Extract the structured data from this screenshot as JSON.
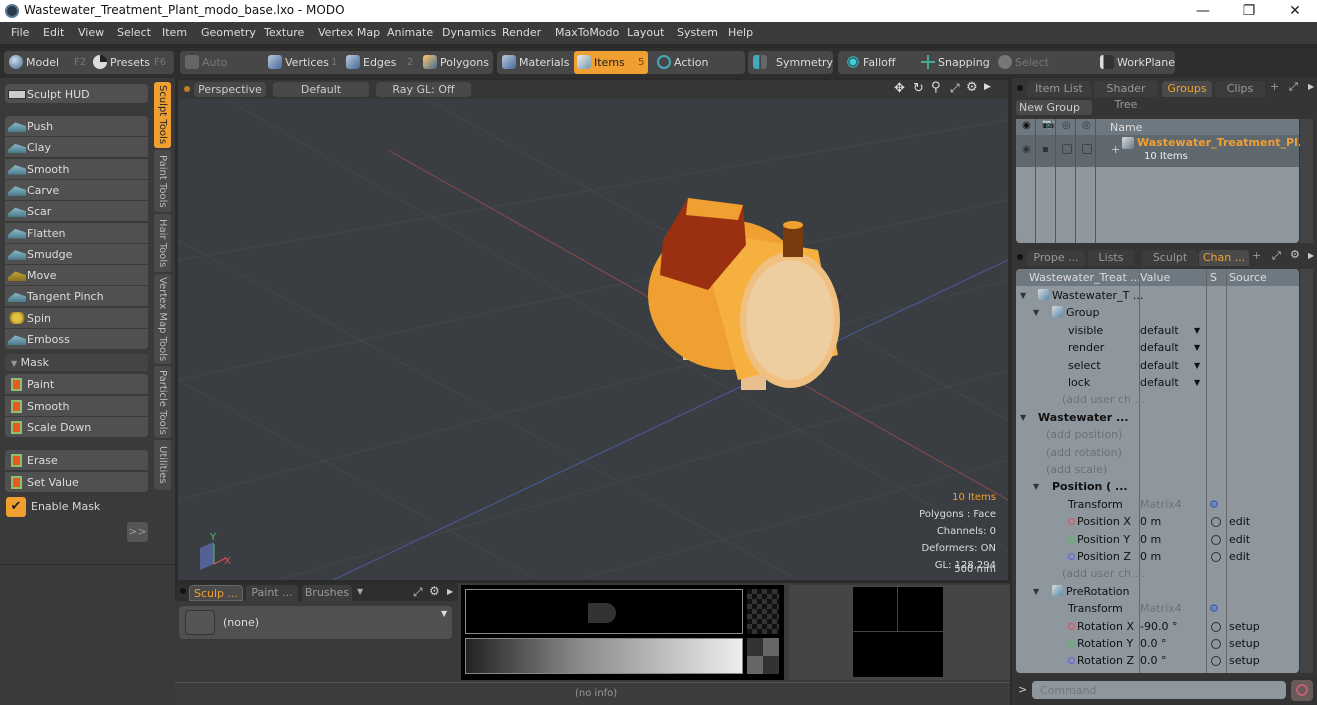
{
  "window": {
    "title": "Wastewater_Treatment_Plant_modo_base.lxo - MODO",
    "minimize": "—",
    "restore": "❐",
    "close": "✕"
  },
  "menu": [
    "File",
    "Edit",
    "View",
    "Select",
    "Item",
    "Geometry",
    "Texture",
    "Vertex Map",
    "Animate",
    "Dynamics",
    "Render",
    "MaxToModo",
    "Layout",
    "System",
    "Help"
  ],
  "toolbar": {
    "model": "Model",
    "model_key": "F2",
    "presets": "Presets",
    "presets_key": "F6",
    "auto_select": "Auto Select",
    "vertices": "Vertices",
    "vertices_key": "1",
    "edges": "Edges",
    "edges_key": "2",
    "polygons": "Polygons",
    "materials": "Materials",
    "items": "Items",
    "items_key": "5",
    "action_center": "Action Center",
    "symmetry": "Symmetry",
    "falloff": "Falloff",
    "snapping": "Snapping",
    "select_through": "Select Through",
    "workplane": "WorkPlane"
  },
  "left": {
    "hud": "Sculpt HUD",
    "tools": [
      "Push",
      "Clay",
      "Smooth",
      "Carve",
      "Scar",
      "Flatten",
      "Smudge",
      "Move",
      "Tangent Pinch",
      "Spin",
      "Emboss"
    ],
    "mask_header": "Mask",
    "mask_tools": [
      "Paint",
      "Smooth",
      "Scale Down"
    ],
    "mask_tools2": [
      "Erase",
      "Set Value"
    ],
    "enable_mask": "Enable Mask",
    "enable_mask_checked": true,
    "more": ">>",
    "vtabs": [
      "Sculpt Tools",
      "Paint Tools",
      "Hair Tools",
      "Vertex Map Tools",
      "Particle Tools",
      "Utilities"
    ]
  },
  "viewport": {
    "view": "Perspective",
    "shading": "Default",
    "raygl": "Ray GL: Off",
    "info": [
      "10 Items",
      "Polygons : Face",
      "Channels: 0",
      "Deformers: ON",
      "GL: 128,294",
      "500 mm"
    ],
    "axis_x": "X",
    "axis_y": "Y"
  },
  "groups_panel": {
    "tabs": [
      "Item List",
      "Shader Tree",
      "Groups",
      "Clips"
    ],
    "active_tab": "Groups",
    "new_group": "New Group",
    "col_name": "Name",
    "group_name": "Wastewater_Treatment_Pl...",
    "group_count": "10 Items"
  },
  "channels_panel": {
    "tabs": [
      "Prope ...",
      "Lists",
      "Sculpt",
      "Chan ..."
    ],
    "active_tab": "Chan ...",
    "cols": [
      "Wastewater_Treat ...",
      "Value",
      "S",
      "Source"
    ],
    "rows": [
      {
        "name": "Wastewater_T ...",
        "value": "",
        "s": "",
        "src": "",
        "indent": 0,
        "style": "item"
      },
      {
        "name": "Group",
        "value": "",
        "s": "",
        "src": "",
        "indent": 1,
        "style": "item"
      },
      {
        "name": "visible",
        "value": "default",
        "s": "",
        "src": "",
        "indent": 2,
        "style": "dd"
      },
      {
        "name": "render",
        "value": "default",
        "s": "",
        "src": "",
        "indent": 2,
        "style": "dd"
      },
      {
        "name": "select",
        "value": "default",
        "s": "",
        "src": "",
        "indent": 2,
        "style": "dd"
      },
      {
        "name": "lock",
        "value": "default",
        "s": "",
        "src": "",
        "indent": 2,
        "style": "dd"
      },
      {
        "name": "(add user ch ...",
        "value": "",
        "s": "",
        "src": "",
        "indent": 2,
        "style": "dim"
      },
      {
        "name": "Wastewater ...",
        "value": "",
        "s": "",
        "src": "",
        "indent": 0,
        "style": "bold"
      },
      {
        "name": "(add position)",
        "value": "",
        "s": "",
        "src": "",
        "indent": 1,
        "style": "dim"
      },
      {
        "name": "(add rotation)",
        "value": "",
        "s": "",
        "src": "",
        "indent": 1,
        "style": "dim"
      },
      {
        "name": "(add scale)",
        "value": "",
        "s": "",
        "src": "",
        "indent": 1,
        "style": "dim"
      },
      {
        "name": "Position ( ...",
        "value": "",
        "s": "",
        "src": "",
        "indent": 1,
        "style": "bold"
      },
      {
        "name": "Transform",
        "value": "Matrix4",
        "s": "gear",
        "src": "",
        "indent": 2,
        "style": "matrix"
      },
      {
        "name": "Position X",
        "value": "0 m",
        "s": "radio",
        "src": "edit",
        "indent": 2,
        "style": "x"
      },
      {
        "name": "Position Y",
        "value": "0 m",
        "s": "radio",
        "src": "edit",
        "indent": 2,
        "style": "y"
      },
      {
        "name": "Position Z",
        "value": "0 m",
        "s": "radio",
        "src": "edit",
        "indent": 2,
        "style": "z"
      },
      {
        "name": "(add user ch ...",
        "value": "",
        "s": "",
        "src": "",
        "indent": 2,
        "style": "dim"
      },
      {
        "name": "PreRotation",
        "value": "",
        "s": "",
        "src": "",
        "indent": 1,
        "style": "item"
      },
      {
        "name": "Transform",
        "value": "Matrix4",
        "s": "gear",
        "src": "",
        "indent": 2,
        "style": "matrix"
      },
      {
        "name": "Rotation X",
        "value": "-90.0 °",
        "s": "radio",
        "src": "setup",
        "indent": 2,
        "style": "x"
      },
      {
        "name": "Rotation Y",
        "value": "0.0 °",
        "s": "radio",
        "src": "setup",
        "indent": 2,
        "style": "y"
      },
      {
        "name": "Rotation Z",
        "value": "0.0 °",
        "s": "radio",
        "src": "setup",
        "indent": 2,
        "style": "z"
      }
    ],
    "command_placeholder": "Command"
  },
  "bottom": {
    "tabs": [
      "Sculp ...",
      "Paint ...",
      "Brushes"
    ],
    "active_tab": "Sculp ...",
    "brush": "(none)",
    "status": "(no info)"
  },
  "colors": {
    "accent": "#f0a030",
    "axis_x": "#e05060",
    "axis_y": "#50c060",
    "axis_z": "#6060e0"
  }
}
